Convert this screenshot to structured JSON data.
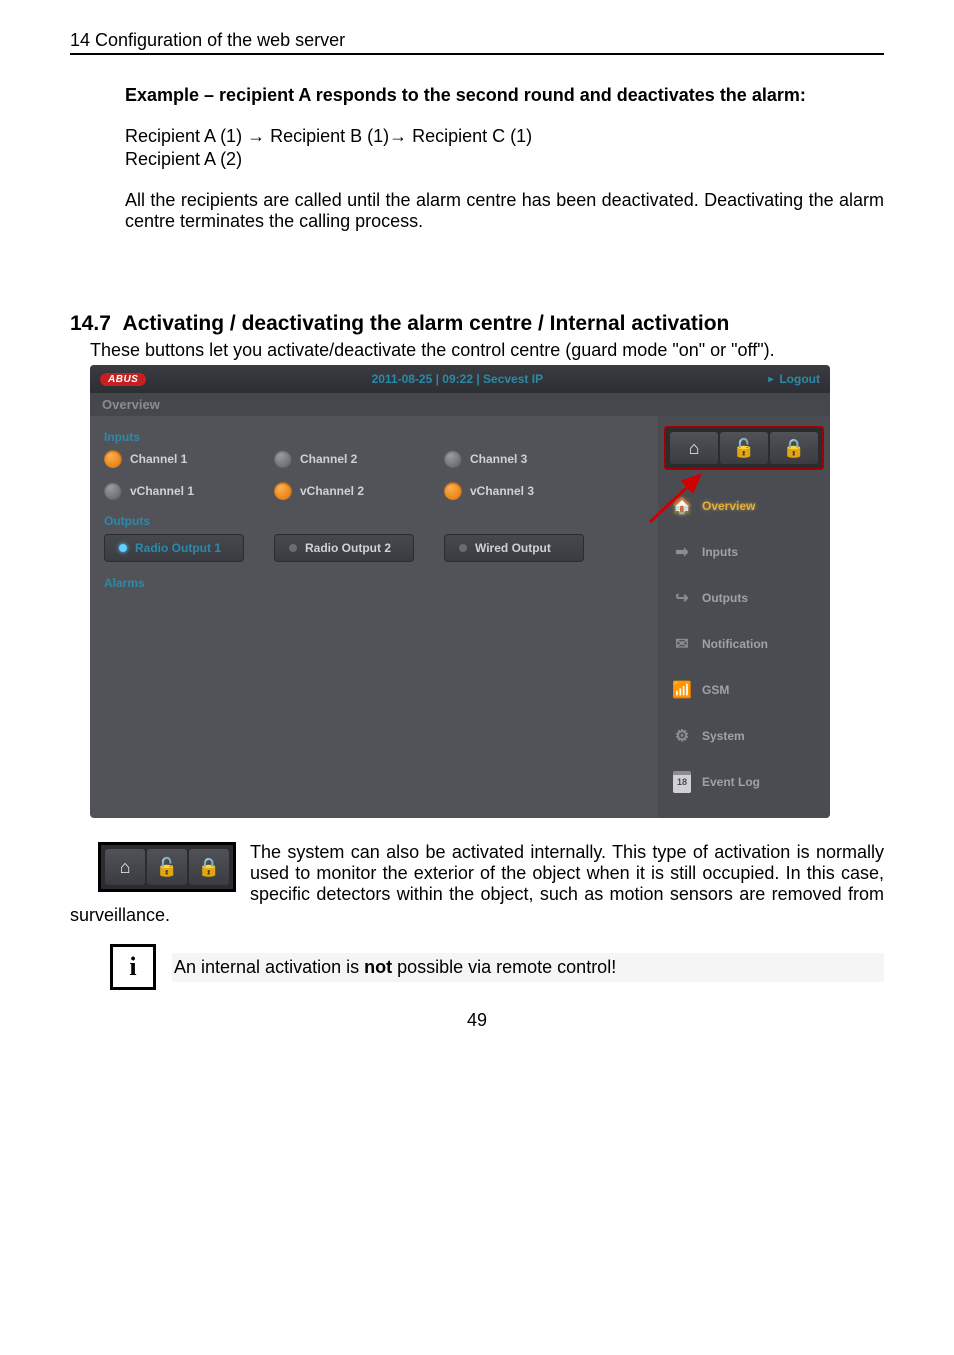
{
  "header": "14  Configuration of the web server",
  "example": {
    "title": "Example – recipient A responds to the second round and deactivates the alarm:",
    "line1": "Recipient A (1) → Recipient B (1)→ Recipient C (1)",
    "line2": "Recipient A (2)",
    "para": "All the recipients are called until the alarm centre has been deactivated. Deactivating the alarm centre terminates the calling process."
  },
  "section": {
    "num": "14.7",
    "title": "Activating / deactivating the alarm centre / Internal activation",
    "desc": "These buttons let you activate/deactivate the control centre (guard mode \"on\" or \"off\")."
  },
  "ui": {
    "logo": "ABUS",
    "datetime": "2011-08-25  |  09:22  |  Secvest IP",
    "logout": "Logout",
    "subtitle": "Overview",
    "labels": {
      "inputs": "Inputs",
      "outputs": "Outputs",
      "alarms": "Alarms"
    },
    "channels_row1": [
      {
        "name": "Channel 1",
        "state": "orange"
      },
      {
        "name": "Channel 2",
        "state": "gray"
      },
      {
        "name": "Channel 3",
        "state": "gray"
      }
    ],
    "channels_row2": [
      {
        "name": "vChannel 1",
        "state": "gray"
      },
      {
        "name": "vChannel 2",
        "state": "orange"
      },
      {
        "name": "vChannel 3",
        "state": "orange"
      }
    ],
    "outputs": [
      {
        "name": "Radio Output 1",
        "on": true
      },
      {
        "name": "Radio Output 2",
        "on": false
      },
      {
        "name": "Wired Output",
        "on": false
      }
    ],
    "sidebar": [
      {
        "label": "Overview",
        "active": true
      },
      {
        "label": "Inputs",
        "active": false
      },
      {
        "label": "Outputs",
        "active": false
      },
      {
        "label": "Notification",
        "active": false
      },
      {
        "label": "GSM",
        "active": false
      },
      {
        "label": "System",
        "active": false
      },
      {
        "label": "Event Log",
        "active": false
      }
    ],
    "calendar_day": "18"
  },
  "after": {
    "para": "The system can also be activated internally. This type of activation is normally used to monitor the exterior of the object when it is still occupied. In this case, specific detectors within the object, such as motion sensors are removed from surveillance.",
    "note_prefix": "An internal activation is ",
    "note_bold": "not",
    "note_suffix": " possible via remote control!"
  },
  "page_num": "49"
}
